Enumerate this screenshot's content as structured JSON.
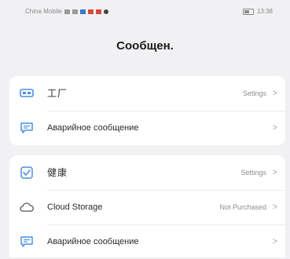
{
  "status_bar": {
    "carrier": "China Mobile",
    "time": "13:38"
  },
  "page": {
    "title": "Сообщен."
  },
  "groups": [
    {
      "items": [
        {
          "label": "工厂",
          "value": "Setings",
          "chevron": ">",
          "icon": "device-icon"
        },
        {
          "label": "Аварийное сообщение",
          "value": "",
          "chevron": ">",
          "icon": "message-icon"
        }
      ]
    },
    {
      "items": [
        {
          "label": "健康",
          "value": "Settings",
          "chevron": ">",
          "icon": "check-icon"
        },
        {
          "label": "Cloud Storage",
          "value": "Not Purchased",
          "chevron": ">",
          "icon": "cloud-icon"
        },
        {
          "label": "Аварийное сообщение",
          "value": "",
          "chevron": ">",
          "icon": "message-icon"
        }
      ]
    }
  ],
  "colors": {
    "accent": "#4a90e2",
    "background": "#f1f1f3",
    "card": "#ffffff"
  }
}
